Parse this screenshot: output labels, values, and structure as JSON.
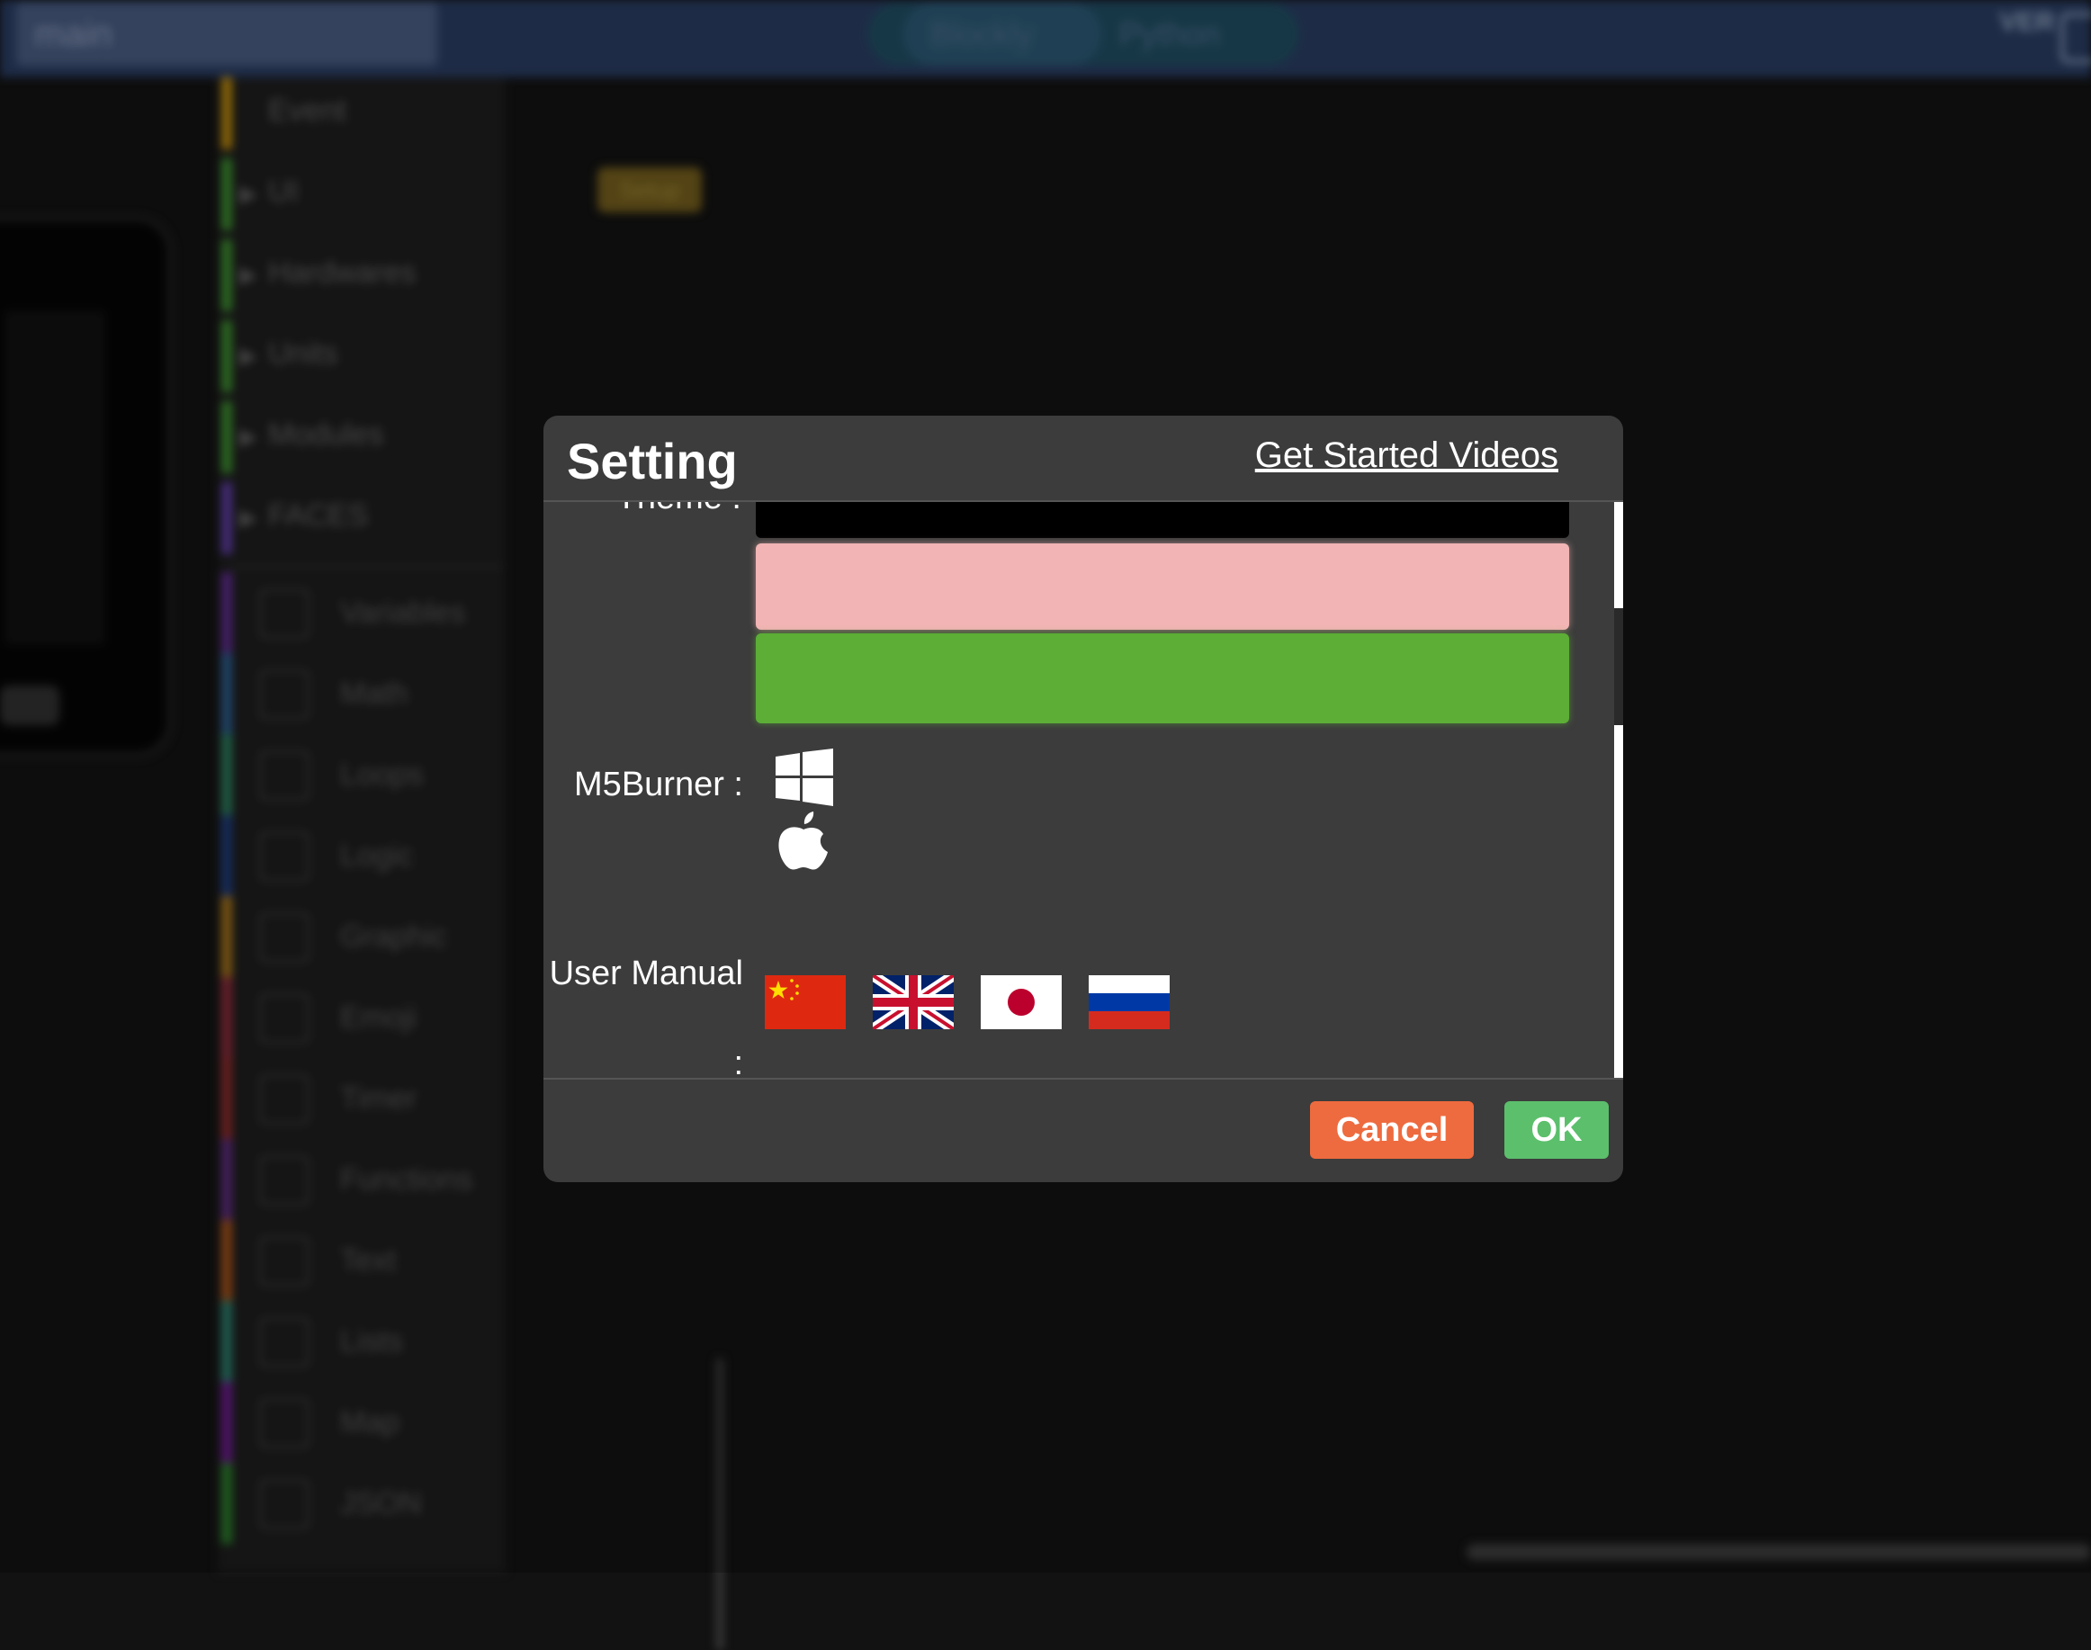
{
  "app": {
    "file_name": "main",
    "modes": [
      "Blockly",
      "Python"
    ],
    "ver_label": "VER",
    "setup_block": "Setup"
  },
  "categories": [
    {
      "label": "Event",
      "color": "#b8860b",
      "expandable": false
    },
    {
      "label": "UI",
      "color": "#3b8a2e",
      "expandable": true
    },
    {
      "label": "Hardwares",
      "color": "#3b8a2e",
      "expandable": true
    },
    {
      "label": "Units",
      "color": "#3b8a2e",
      "expandable": true
    },
    {
      "label": "Modules",
      "color": "#3b8a2e",
      "expandable": true
    },
    {
      "label": "FACES",
      "color": "#5b3a9e",
      "expandable": true
    }
  ],
  "tools": [
    {
      "label": "Variables",
      "color": "#5b2a8a",
      "icon": "variables-icon"
    },
    {
      "label": "Math",
      "color": "#2a5a8a",
      "icon": "math-icon"
    },
    {
      "label": "Loops",
      "color": "#2a7a5a",
      "icon": "loops-icon"
    },
    {
      "label": "Logic",
      "color": "#1e3a7a",
      "icon": "logic-icon"
    },
    {
      "label": "Graphic",
      "color": "#a0701a",
      "icon": "graphic-icon"
    },
    {
      "label": "Emoji",
      "color": "#8a2a3a",
      "icon": "emoji-icon"
    },
    {
      "label": "Timer",
      "color": "#8a2a2a",
      "icon": "timer-icon"
    },
    {
      "label": "Functions",
      "color": "#5a2a7a",
      "icon": "functions-icon"
    },
    {
      "label": "Text",
      "color": "#a0501a",
      "icon": "text-icon"
    },
    {
      "label": "Lists",
      "color": "#2a7a6a",
      "icon": "lists-icon"
    },
    {
      "label": "Map",
      "color": "#6a1a8a",
      "icon": "map-icon"
    },
    {
      "label": "JSON",
      "color": "#2a7a2a",
      "icon": "json-icon"
    }
  ],
  "dialog": {
    "title": "Setting",
    "videos_link": "Get Started Videos",
    "theme_label": "Theme :",
    "theme_options": [
      {
        "name": "black",
        "color": "#000000"
      },
      {
        "name": "pink",
        "color": "#f2b4b4"
      },
      {
        "name": "green",
        "color": "#5cae36"
      }
    ],
    "m5burner_label": "M5Burner :",
    "m5burner_platforms": [
      "windows-icon",
      "apple-icon"
    ],
    "manual_label": "User Manual :",
    "manual_languages": [
      "flag-cn",
      "flag-uk",
      "flag-jp",
      "flag-ru"
    ],
    "cancel_label": "Cancel",
    "ok_label": "OK",
    "colors": {
      "cancel": "#ee6b3f",
      "ok": "#5cbf6c",
      "background": "#3c3c3c"
    }
  }
}
